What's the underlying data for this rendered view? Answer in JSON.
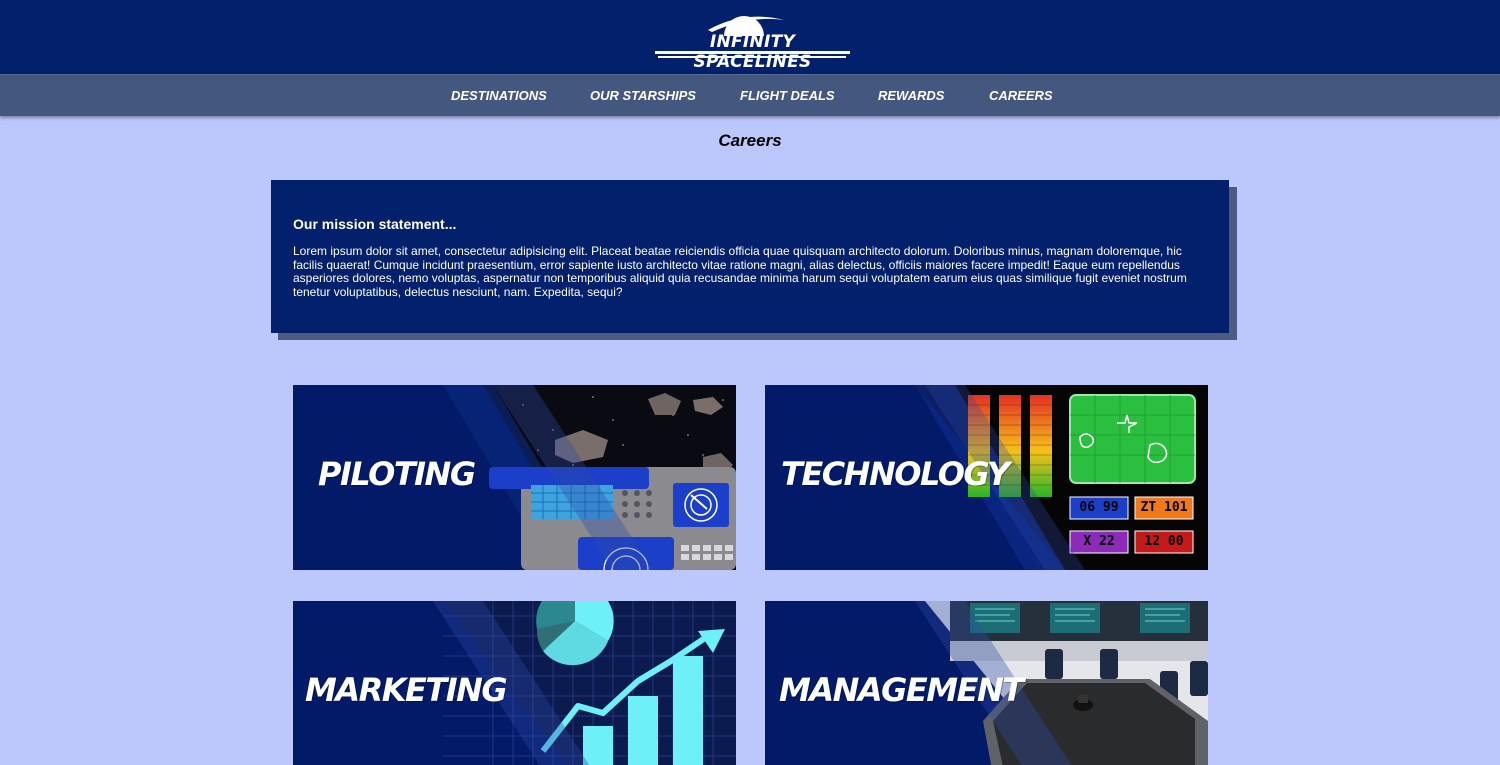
{
  "brand": {
    "logo_text": "INFINITY SPACELINES"
  },
  "nav": {
    "items": [
      {
        "label": "DESTINATIONS"
      },
      {
        "label": "OUR STARSHIPS"
      },
      {
        "label": "FLIGHT DEALS"
      },
      {
        "label": "REWARDS"
      },
      {
        "label": "CAREERS"
      }
    ]
  },
  "page": {
    "title": "Careers"
  },
  "mission": {
    "heading": "Our mission statement...",
    "body": "Lorem ipsum dolor sit amet, consectetur adipisicing elit. Placeat beatae reiciendis officia quae quisquam architecto dolorum. Doloribus minus, magnam doloremque, hic facilis quaerat! Cumque incidunt praesentium, error sapiente iusto architecto vitae ratione magni, alias delectus, officiis maiores facere impedit! Eaque eum repellendus asperiores dolores, nemo voluptas, aspernatur non temporibus aliquid quia recusandae minima harum sequi voluptatem earum eius quas similique fugit eveniet nostrum tenetur voluptatibus, delectus nesciunt, nam. Expedita, sequi?"
  },
  "cards": [
    {
      "label": "PILOTING",
      "icon": "cockpit-asteroids-image"
    },
    {
      "label": "TECHNOLOGY",
      "icon": "control-panel-image",
      "readouts": [
        "06 99",
        "ZT 101",
        "X 22",
        "12 00"
      ]
    },
    {
      "label": "MARKETING",
      "icon": "growth-chart-image"
    },
    {
      "label": "MANAGEMENT",
      "icon": "conference-room-image"
    }
  ],
  "colors": {
    "header": "#02206b",
    "nav": "#44577f",
    "background": "#bcc8fc",
    "card": "#031a68"
  }
}
